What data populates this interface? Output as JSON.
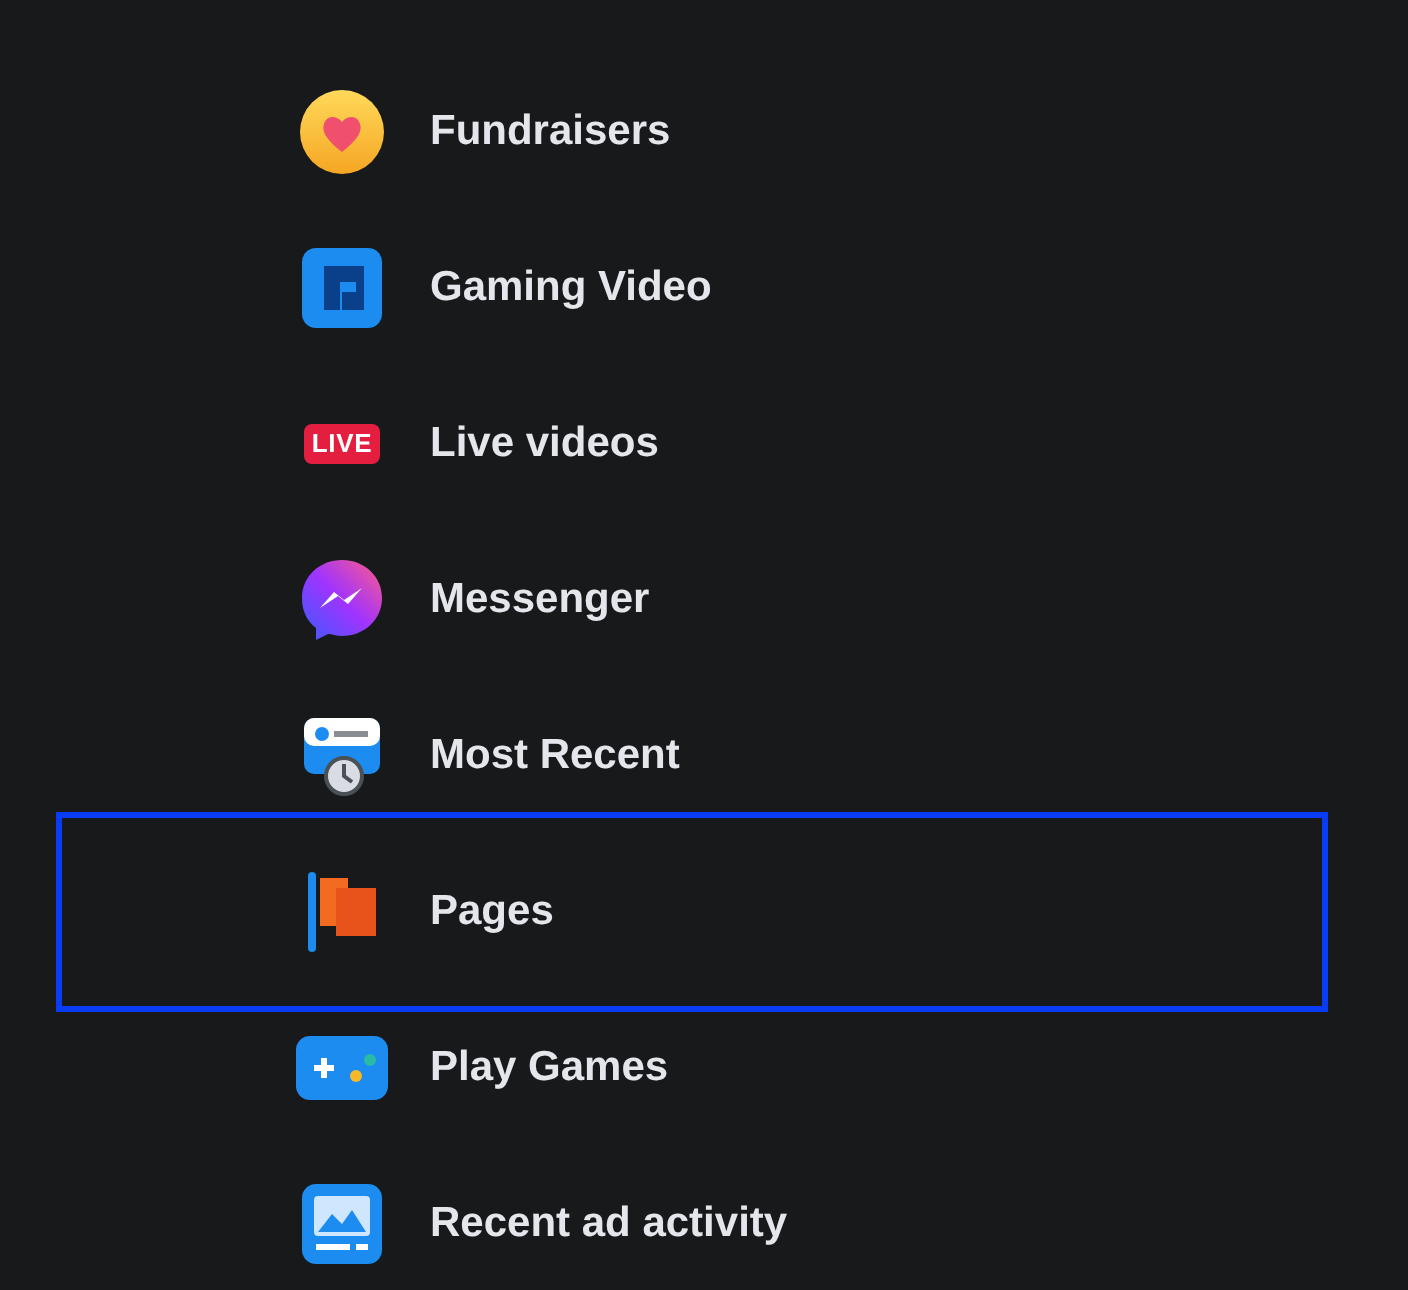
{
  "menu": {
    "items": [
      {
        "label": "Fundraisers",
        "kind": "fundraisers",
        "selected": false
      },
      {
        "label": "Gaming Video",
        "kind": "gaming",
        "selected": false
      },
      {
        "label": "Live videos",
        "kind": "live",
        "badge": "LIVE",
        "selected": false
      },
      {
        "label": "Messenger",
        "kind": "messenger",
        "selected": false
      },
      {
        "label": "Most Recent",
        "kind": "recent",
        "selected": false
      },
      {
        "label": "Pages",
        "kind": "pages",
        "selected": true
      },
      {
        "label": "Play Games",
        "kind": "games",
        "selected": false
      },
      {
        "label": "Recent ad activity",
        "kind": "ads",
        "selected": false
      }
    ]
  }
}
